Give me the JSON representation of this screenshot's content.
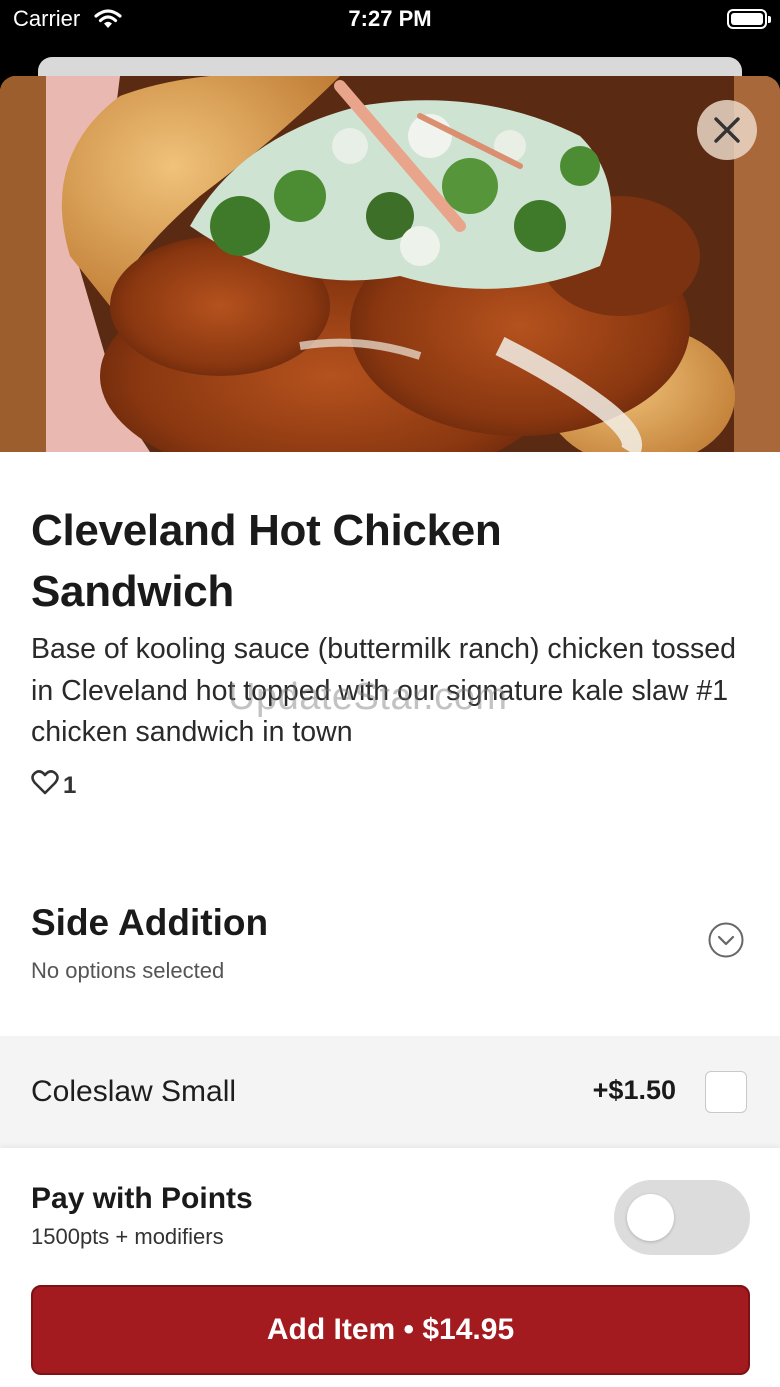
{
  "status_bar": {
    "carrier": "Carrier",
    "time": "7:27 PM"
  },
  "item": {
    "title": "Cleveland Hot Chicken Sandwich",
    "description": "Base of kooling sauce (buttermilk ranch) chicken tossed in Cleveland hot topped with our signature kale slaw #1 chicken sandwich in town",
    "likes": "1"
  },
  "watermark": "UpdateStar.com",
  "side_addition": {
    "title": "Side Addition",
    "subtitle": "No options selected",
    "options": [
      {
        "name": "Coleslaw Small",
        "price": "+$1.50",
        "checked": false
      }
    ]
  },
  "points": {
    "title": "Pay with Points",
    "subtitle": "1500pts + modifiers",
    "enabled": false
  },
  "add_button": {
    "label": "Add Item • $14.95"
  },
  "colors": {
    "accent": "#a31a1f",
    "option_bg": "#f4f4f4",
    "toggle_off": "#dcdcdc"
  },
  "icons": {
    "close": "close-icon",
    "like": "heart-icon",
    "expand": "chevron-down-icon"
  }
}
